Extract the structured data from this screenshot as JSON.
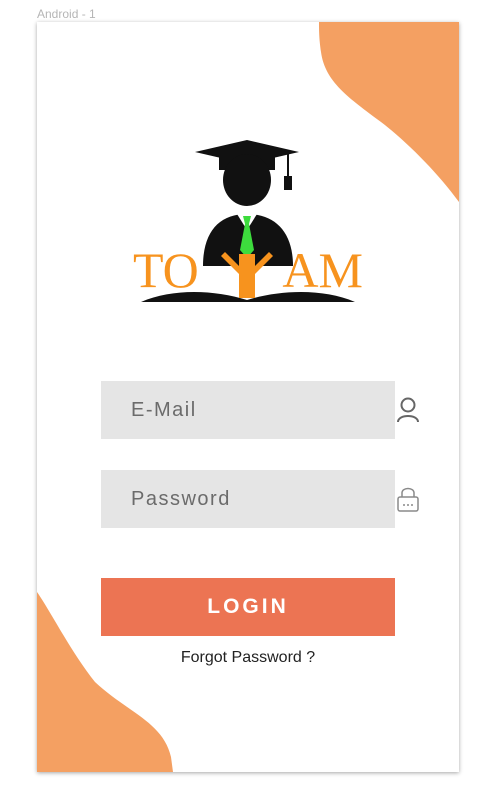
{
  "canvas": {
    "label": "Android - 1"
  },
  "logo": {
    "text_left": "TO",
    "text_right": "AM",
    "icon": "graduate-with-book-logo"
  },
  "form": {
    "email": {
      "placeholder": "E-Mail",
      "value": "",
      "icon": "user-icon"
    },
    "password": {
      "placeholder": "Password",
      "value": "",
      "icon": "lock-icon"
    },
    "login_label": "LOGIN",
    "forgot_label": "Forgot Password ?"
  },
  "colors": {
    "accent_blob": "#f4a062",
    "login_button": "#ec7453",
    "field_bg": "#e5e5e5",
    "logo_text": "#f7931e",
    "tie": "#3ddc3d"
  }
}
